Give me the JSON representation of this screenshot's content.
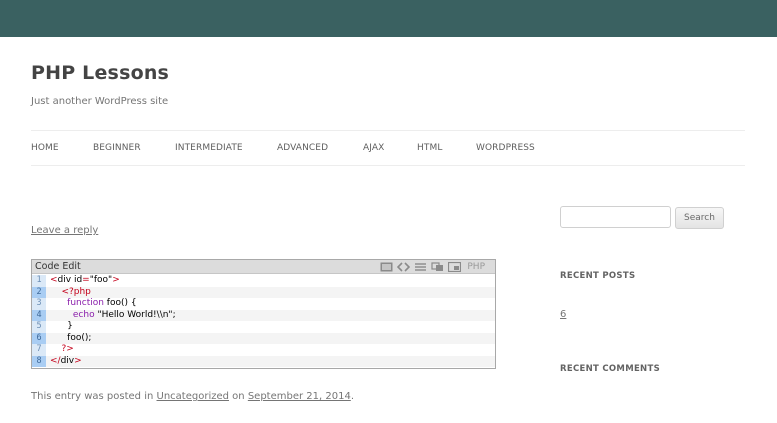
{
  "site": {
    "title": "PHP Lessons",
    "description": "Just another WordPress site"
  },
  "nav": [
    {
      "label": "HOME"
    },
    {
      "label": "BEGINNER"
    },
    {
      "label": "INTERMEDIATE"
    },
    {
      "label": "ADVANCED"
    },
    {
      "label": "AJAX"
    },
    {
      "label": "HTML"
    },
    {
      "label": "WORDPRESS"
    }
  ],
  "post": {
    "reply_label": "Leave a reply",
    "meta_prefix": "This entry was posted in",
    "category": "Uncategorized",
    "meta_on": "on",
    "date": "September 21, 2014",
    "meta_suffix": "."
  },
  "code_block": {
    "header": "Code Edit",
    "language": "PHP",
    "tool_icons": [
      "view-source-icon",
      "code-brackets-icon",
      "wrap-lines-icon",
      "copy-icon",
      "popup-icon"
    ],
    "lines": [
      {
        "num": "1",
        "parts": [
          {
            "t": "<",
            "c": "red"
          },
          {
            "t": "div id",
            "c": "blk"
          },
          {
            "t": "=",
            "c": "red"
          },
          {
            "t": "\"foo\"",
            "c": "blk"
          },
          {
            "t": ">",
            "c": "red"
          }
        ]
      },
      {
        "num": "2",
        "parts": [
          {
            "t": "    <?php",
            "c": "red"
          }
        ]
      },
      {
        "num": "3",
        "parts": [
          {
            "t": "      ",
            "c": "blk"
          },
          {
            "t": "function",
            "c": "purple"
          },
          {
            "t": " foo() {",
            "c": "blk"
          }
        ]
      },
      {
        "num": "4",
        "parts": [
          {
            "t": "        ",
            "c": "blk"
          },
          {
            "t": "echo",
            "c": "purple"
          },
          {
            "t": " \"Hello World!\\\\n\";",
            "c": "blk"
          }
        ]
      },
      {
        "num": "5",
        "parts": [
          {
            "t": "      }",
            "c": "blk"
          }
        ]
      },
      {
        "num": "6",
        "parts": [
          {
            "t": "      foo();",
            "c": "blk"
          }
        ]
      },
      {
        "num": "7",
        "parts": [
          {
            "t": "    ?>",
            "c": "red"
          }
        ]
      },
      {
        "num": "8",
        "parts": [
          {
            "t": "</",
            "c": "red"
          },
          {
            "t": "div",
            "c": "blk"
          },
          {
            "t": ">",
            "c": "red"
          }
        ]
      }
    ]
  },
  "sidebar": {
    "search_value": "",
    "search_button": "Search",
    "recent_posts_title": "RECENT POSTS",
    "recent_post_link": "6",
    "recent_comments_title": "RECENT COMMENTS"
  },
  "colors": {
    "topbar": "#3a6161",
    "code_red": "#c4001a",
    "code_purple": "#8a1eab"
  }
}
